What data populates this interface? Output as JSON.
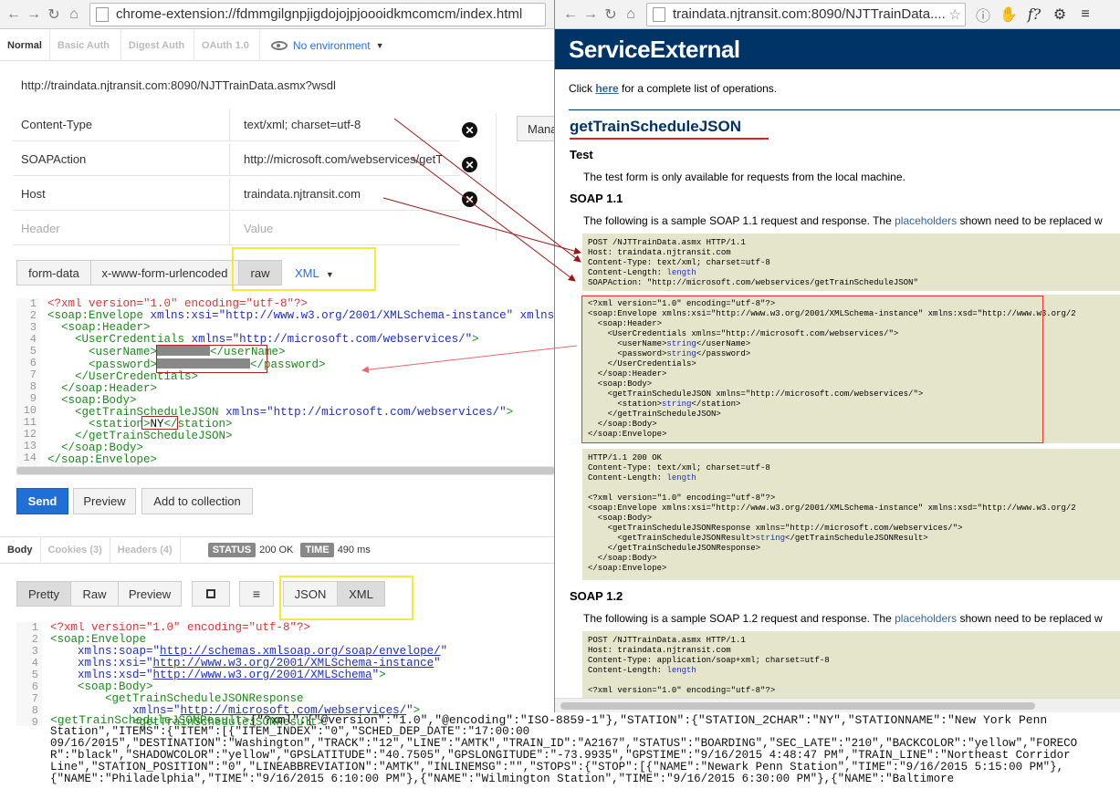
{
  "left_window": {
    "url": "chrome-extension://fdmmgilgnpjigdojojpjoooidkmcomcm/index.html",
    "auth_tabs": [
      "Normal",
      "Basic Auth",
      "Digest Auth",
      "OAuth 1.0"
    ],
    "environment": "No environment",
    "request_url": "http://traindata.njtransit.com:8090/NJTTrainData.asmx?wsdl",
    "headers": [
      {
        "key": "Content-Type",
        "value": "text/xml; charset=utf-8"
      },
      {
        "key": "SOAPAction",
        "value": "http://microsoft.com/webservices/getT"
      },
      {
        "key": "Host",
        "value": "traindata.njtransit.com"
      }
    ],
    "header_placeholder_key": "Header",
    "header_placeholder_value": "Value",
    "manage_label": "Mana",
    "body_modes": [
      "form-data",
      "x-www-form-urlencoded",
      "raw"
    ],
    "body_format": "XML",
    "request_lines": [
      "1",
      "2",
      "3",
      "4",
      "5",
      "6",
      "7",
      "8",
      "9",
      "10",
      "11",
      "12",
      "13",
      "14"
    ],
    "actions": {
      "send": "Send",
      "preview": "Preview",
      "add": "Add to collection"
    },
    "response_tabs": [
      "Body",
      "Cookies (3)",
      "Headers (4)"
    ],
    "status_label": "STATUS",
    "status_value": "200 OK",
    "time_label": "TIME",
    "time_value": "490 ms",
    "view_modes": [
      "Pretty",
      "Raw",
      "Preview"
    ],
    "formats": [
      "JSON",
      "XML"
    ]
  },
  "right_window": {
    "url": "traindata.njtransit.com:8090/NJTTrainData....",
    "service_title": "ServiceExternal",
    "intro_pre": "Click",
    "intro_link": "here",
    "intro_post": "for a complete list of operations.",
    "operation": "getTrainScheduleJSON",
    "test_heading": "Test",
    "test_text": "The test form is only available for requests from the local machine.",
    "soap11_heading": "SOAP 1.1",
    "soap11_text_pre": "The following is a sample SOAP 1.1 request and response. The",
    "placeholders_link": "placeholders",
    "soap11_text_post": "shown need to be replaced w",
    "soap12_heading": "SOAP 1.2",
    "soap12_text_pre": "The following is a sample SOAP 1.2 request and response. The",
    "soap12_text_post": "shown need to be replaced w"
  }
}
